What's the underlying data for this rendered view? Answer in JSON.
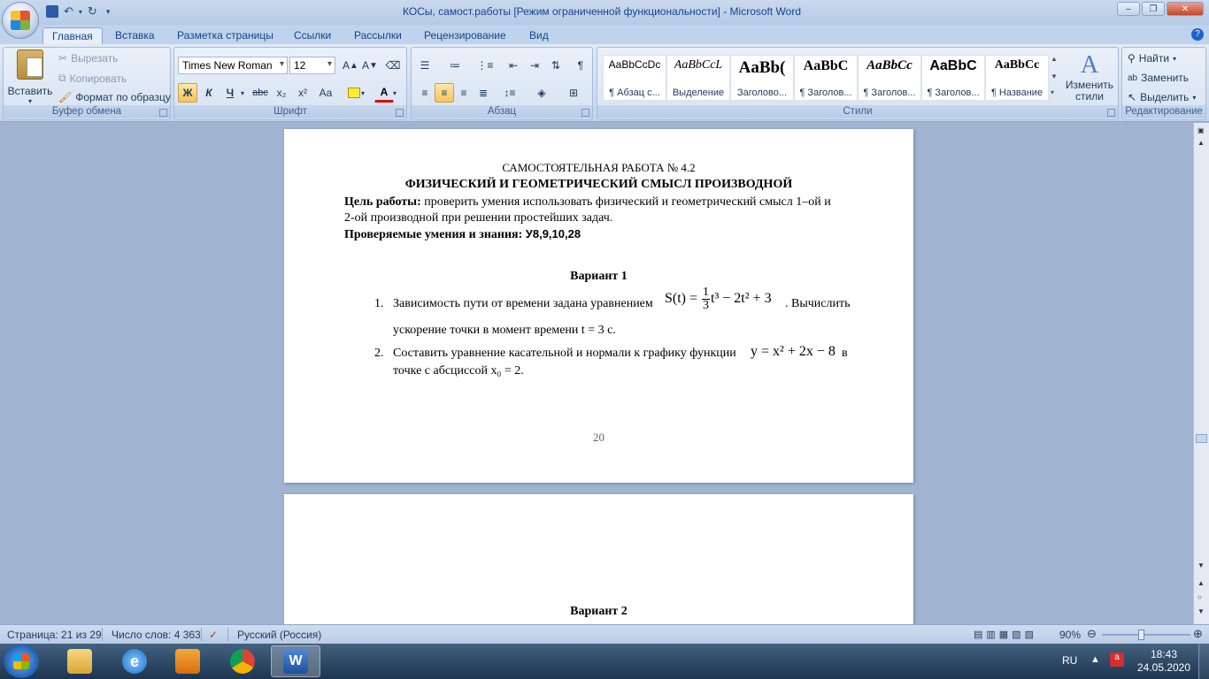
{
  "window": {
    "title": "КОСы, самост.работы [Режим ограниченной функциональности] - Microsoft Word",
    "controls": [
      "–",
      "❐",
      "✕"
    ]
  },
  "tabs": [
    "Главная",
    "Вставка",
    "Разметка страницы",
    "Ссылки",
    "Рассылки",
    "Рецензирование",
    "Вид"
  ],
  "ribbon": {
    "clipboard": {
      "label": "Буфер обмена",
      "paste": "Вставить",
      "cut": "Вырезать",
      "copy": "Копировать",
      "format_painter": "Формат по образцу"
    },
    "font": {
      "label": "Шрифт",
      "name": "Times New Roman",
      "size": "12",
      "bold": "Ж",
      "italic": "К",
      "underline": "Ч",
      "strike": "abc",
      "subscript": "x₂",
      "superscript": "x²",
      "case": "Aa"
    },
    "paragraph": {
      "label": "Абзац"
    },
    "styles": {
      "label": "Стили",
      "items": [
        {
          "sample": "AaBbCcDc",
          "name": "¶ Абзац с..."
        },
        {
          "sample": "AaBbCcL",
          "name": "Выделение"
        },
        {
          "sample": "AaBb(",
          "name": "Заголово..."
        },
        {
          "sample": "AaBbC",
          "name": "¶ Заголов..."
        },
        {
          "sample": "AaBbCc",
          "name": "¶ Заголов..."
        },
        {
          "sample": "AaBbC",
          "name": "¶ Заголов..."
        },
        {
          "sample": "AaBbCc",
          "name": "¶ Название"
        }
      ],
      "change": "Изменить стили"
    },
    "editing": {
      "label": "Редактирование",
      "find": "Найти",
      "replace": "Заменить",
      "select": "Выделить"
    }
  },
  "document": {
    "heading1": "САМОСТОЯТЕЛЬНАЯ  РАБОТА № 4.2",
    "heading2": "ФИЗИЧЕСКИЙ  И ГЕОМЕТРИЧЕСКИЙ  СМЫСЛ ПРОИЗВОДНОЙ",
    "goal_label": "Цель работы:",
    "goal_text": " проверить умения использовать физический и геометрический смысл 1–ой и",
    "goal_text2": "2-ой производной при решении простейших задач.",
    "skills_label": "Проверяемые умения  и знания: ",
    "skills_value": "У8,9,10,28",
    "variant1": "Вариант 1",
    "task1_num": "1.",
    "task1_text": "Зависимость пути от времени задана уравнением",
    "task1_formula_left": "S(t) = ",
    "task1_formula_num": "1",
    "task1_formula_den": "3",
    "task1_formula_right": "t³ − 2t² + 3",
    "task1_text_after": ". Вычислить",
    "task1_line2": "ускорение точки в момент времени t = 3 с.",
    "task2_num": "2.",
    "task2_text": "Составить уравнение касательной  и нормали к графику функции",
    "task2_formula": "y = x² + 2x − 8",
    "task2_text_after": " в",
    "task2_line2": "точке с абсциссой x₀ = 2.",
    "page_number": "20",
    "variant2": "Вариант 2"
  },
  "statusbar": {
    "page": "Страница: 21 из 29",
    "words": "Число слов: 4 363",
    "language": "Русский (Россия)",
    "zoom": "90%"
  },
  "taskbar": {
    "lang": "RU",
    "time": "18:43",
    "date": "24.05.2020"
  }
}
